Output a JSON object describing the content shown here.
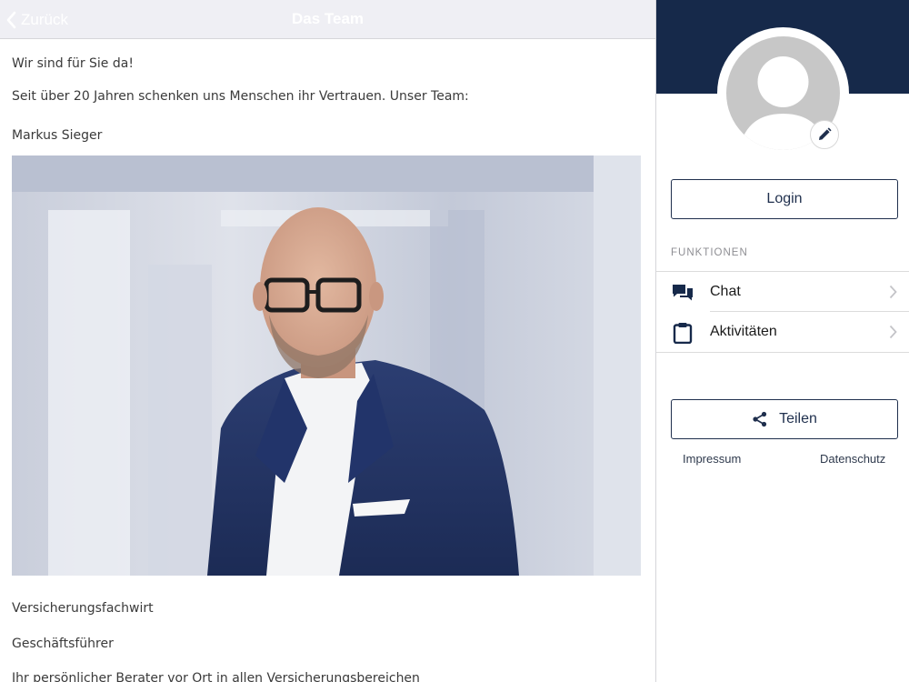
{
  "navbar": {
    "back_label": "Zurück",
    "title": "Das Team"
  },
  "content": {
    "greeting": "Wir sind für Sie da!",
    "intro": "Seit über 20 Jahren schenken uns Menschen ihr Vertrauen. Unser Team:",
    "person_name": "Markus Sieger",
    "qualification": "Versicherungsfachwirt",
    "position": "Geschäftsführer",
    "description": "Ihr persönlicher Berater vor Ort in allen Versicherungsbereichen"
  },
  "sidebar": {
    "login_label": "Login",
    "section_title": "FUNKTIONEN",
    "menu": [
      {
        "label": "Chat",
        "icon": "chat-icon"
      },
      {
        "label": "Aktivitäten",
        "icon": "clipboard-icon"
      }
    ],
    "share_label": "Teilen",
    "footer_links": {
      "imprint": "Impressum",
      "privacy": "Datenschutz"
    }
  },
  "colors": {
    "header_band": "#16294a",
    "accent": "#1f2f4d",
    "navbar_bg": "#efeff4"
  }
}
